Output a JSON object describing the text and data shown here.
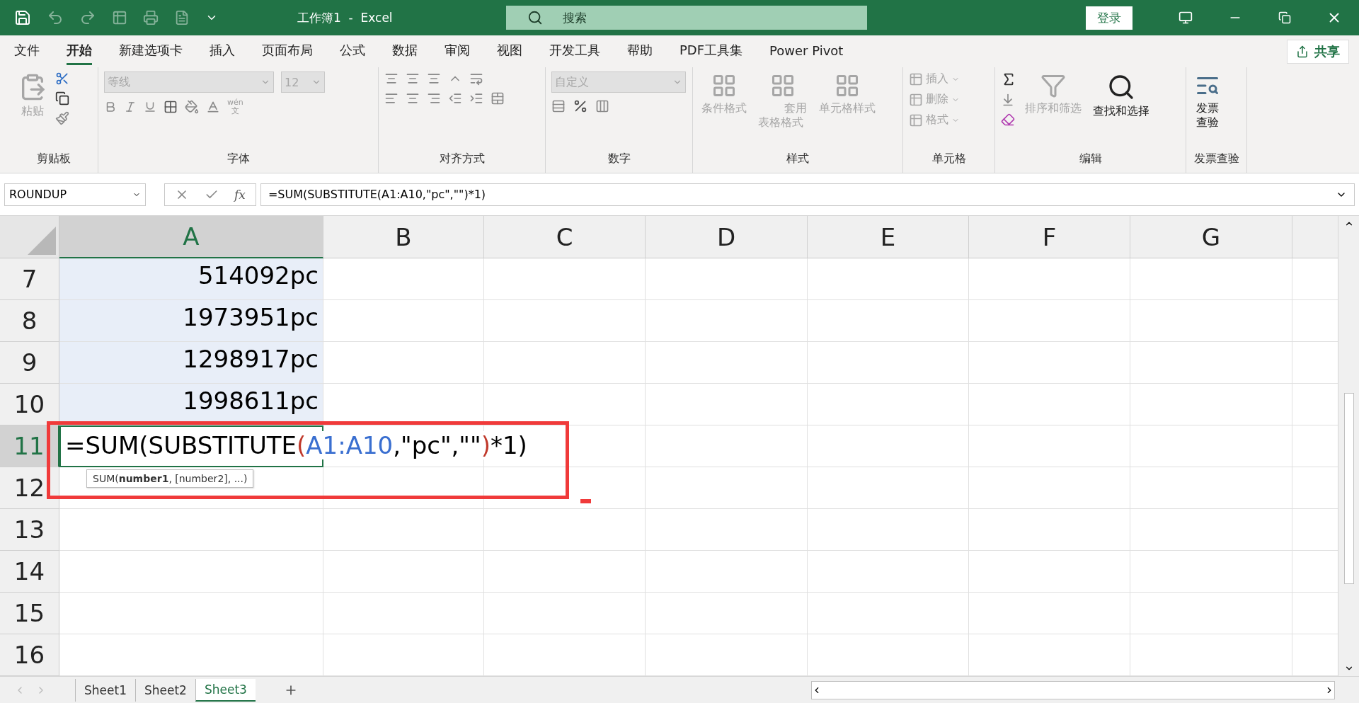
{
  "title_bar": {
    "title": "工作簿1  -  Excel",
    "search_placeholder": "搜索",
    "login": "登录"
  },
  "menu_tabs": [
    {
      "label": "文件",
      "selected": false
    },
    {
      "label": "开始",
      "selected": true
    },
    {
      "label": "新建选项卡",
      "selected": false
    },
    {
      "label": "插入",
      "selected": false
    },
    {
      "label": "页面布局",
      "selected": false
    },
    {
      "label": "公式",
      "selected": false
    },
    {
      "label": "数据",
      "selected": false
    },
    {
      "label": "审阅",
      "selected": false
    },
    {
      "label": "视图",
      "selected": false
    },
    {
      "label": "开发工具",
      "selected": false
    },
    {
      "label": "帮助",
      "selected": false
    },
    {
      "label": "PDF工具集",
      "selected": false
    },
    {
      "label": "Power Pivot",
      "selected": false
    }
  ],
  "share": "共享",
  "ribbon": {
    "clipboard": {
      "title": "剪贴板",
      "paste": {
        "label": "粘贴",
        "disabled": true
      }
    },
    "font": {
      "title": "字体",
      "font_name": {
        "value": "等线",
        "disabled": true
      },
      "font_size": {
        "value": "12",
        "disabled": true
      },
      "phonetic_top": "wén",
      "phonetic_bottom": "文"
    },
    "alignment": {
      "title": "对齐方式"
    },
    "number": {
      "title": "数字",
      "format": {
        "value": "自定义",
        "disabled": true
      }
    },
    "styles": {
      "title": "样式",
      "buttons": [
        {
          "label": "条件格式",
          "disabled": true
        },
        {
          "label": "套用表格格式",
          "disabled": true
        },
        {
          "label": "单元格样式",
          "disabled": true
        }
      ]
    },
    "cells": {
      "title": "单元格",
      "buttons": [
        {
          "label": "插入",
          "disabled": true
        },
        {
          "label": "删除",
          "disabled": true
        },
        {
          "label": "格式",
          "disabled": true
        }
      ]
    },
    "editing": {
      "title": "编辑",
      "buttons": [
        {
          "label": "排序和筛选",
          "disabled": true
        },
        {
          "label": "查找和选择",
          "disabled": false
        }
      ]
    },
    "invoice": {
      "title": "发票查验",
      "button": {
        "label": "发票查验"
      }
    }
  },
  "formula_bar": {
    "name_box": "ROUNDUP",
    "fx": "fx",
    "formula": "=SUM(SUBSTITUTE(A1:A10,\"pc\",\"\")*1)"
  },
  "columns": [
    {
      "label": "A",
      "selected": true
    },
    {
      "label": "B",
      "selected": false
    },
    {
      "label": "C",
      "selected": false
    },
    {
      "label": "D",
      "selected": false
    },
    {
      "label": "E",
      "selected": false
    },
    {
      "label": "F",
      "selected": false
    },
    {
      "label": "G",
      "selected": false
    }
  ],
  "rows": [
    {
      "number": "7",
      "active": false,
      "kind": "value",
      "a_value": "514092pc",
      "a_selected": true
    },
    {
      "number": "8",
      "active": false,
      "kind": "value",
      "a_value": "1973951pc",
      "a_selected": true
    },
    {
      "number": "9",
      "active": false,
      "kind": "value",
      "a_value": "1298917pc",
      "a_selected": true
    },
    {
      "number": "10",
      "active": false,
      "kind": "value",
      "a_value": "1998611pc",
      "a_selected": true
    },
    {
      "number": "11",
      "active": true,
      "kind": "editing",
      "a_selected": false,
      "segments": [
        {
          "text": "=SUM(SUBSTITUTE",
          "color": "#000000"
        },
        {
          "text": "(",
          "color": "#c0392b"
        },
        {
          "text": "A1:A10",
          "color": "#3a6fd0"
        },
        {
          "text": ",\"pc\",\"\"",
          "color": "#000000"
        },
        {
          "text": ")",
          "color": "#c0392b"
        },
        {
          "text": "*1)",
          "color": "#000000"
        }
      ],
      "tooltip": "SUM(**number1**, [number2], ...)"
    },
    {
      "number": "12",
      "active": false,
      "kind": "empty",
      "a_selected": false
    },
    {
      "number": "13",
      "active": false,
      "kind": "empty",
      "a_selected": false
    },
    {
      "number": "14",
      "active": false,
      "kind": "empty",
      "a_selected": false
    },
    {
      "number": "15",
      "active": false,
      "kind": "empty",
      "a_selected": false
    },
    {
      "number": "16",
      "active": false,
      "kind": "empty",
      "a_selected": false
    }
  ],
  "sheets": [
    {
      "label": "Sheet1",
      "selected": false
    },
    {
      "label": "Sheet2",
      "selected": false
    },
    {
      "label": "Sheet3",
      "selected": true
    }
  ]
}
